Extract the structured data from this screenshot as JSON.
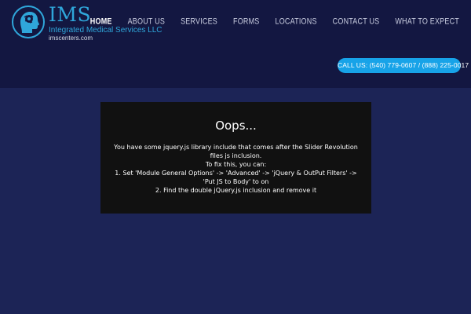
{
  "brand": {
    "title": "IMS",
    "subtitle": "Integrated Medical Services LLC",
    "url": "imscenters.com",
    "accent": "#2fa6da"
  },
  "nav": {
    "items": [
      {
        "label": "HOME",
        "active": true
      },
      {
        "label": "ABOUT US"
      },
      {
        "label": "SERVICES"
      },
      {
        "label": "FORMS"
      },
      {
        "label": "LOCATIONS"
      },
      {
        "label": "CONTACT US"
      },
      {
        "label": "WHAT TO EXPECT"
      }
    ]
  },
  "call": {
    "label": "CALL US: (540) 779-0607 / (888) 225-0017",
    "color": "#17a3e8"
  },
  "error": {
    "title": "Oops...",
    "line1": "You have some jquery.js library include that comes after the Slider Revolution files js inclusion.",
    "line2": "To fix this, you can:",
    "line3": "1. Set 'Module General Options' -> 'Advanced' -> 'jQuery & OutPut Filters' -> 'Put JS to Body' to on",
    "line4": "2. Find the double jQuery.js inclusion and remove it"
  },
  "colors": {
    "header_bg": "#131741",
    "page_bg": "#1c2456",
    "box_bg": "#111111"
  }
}
